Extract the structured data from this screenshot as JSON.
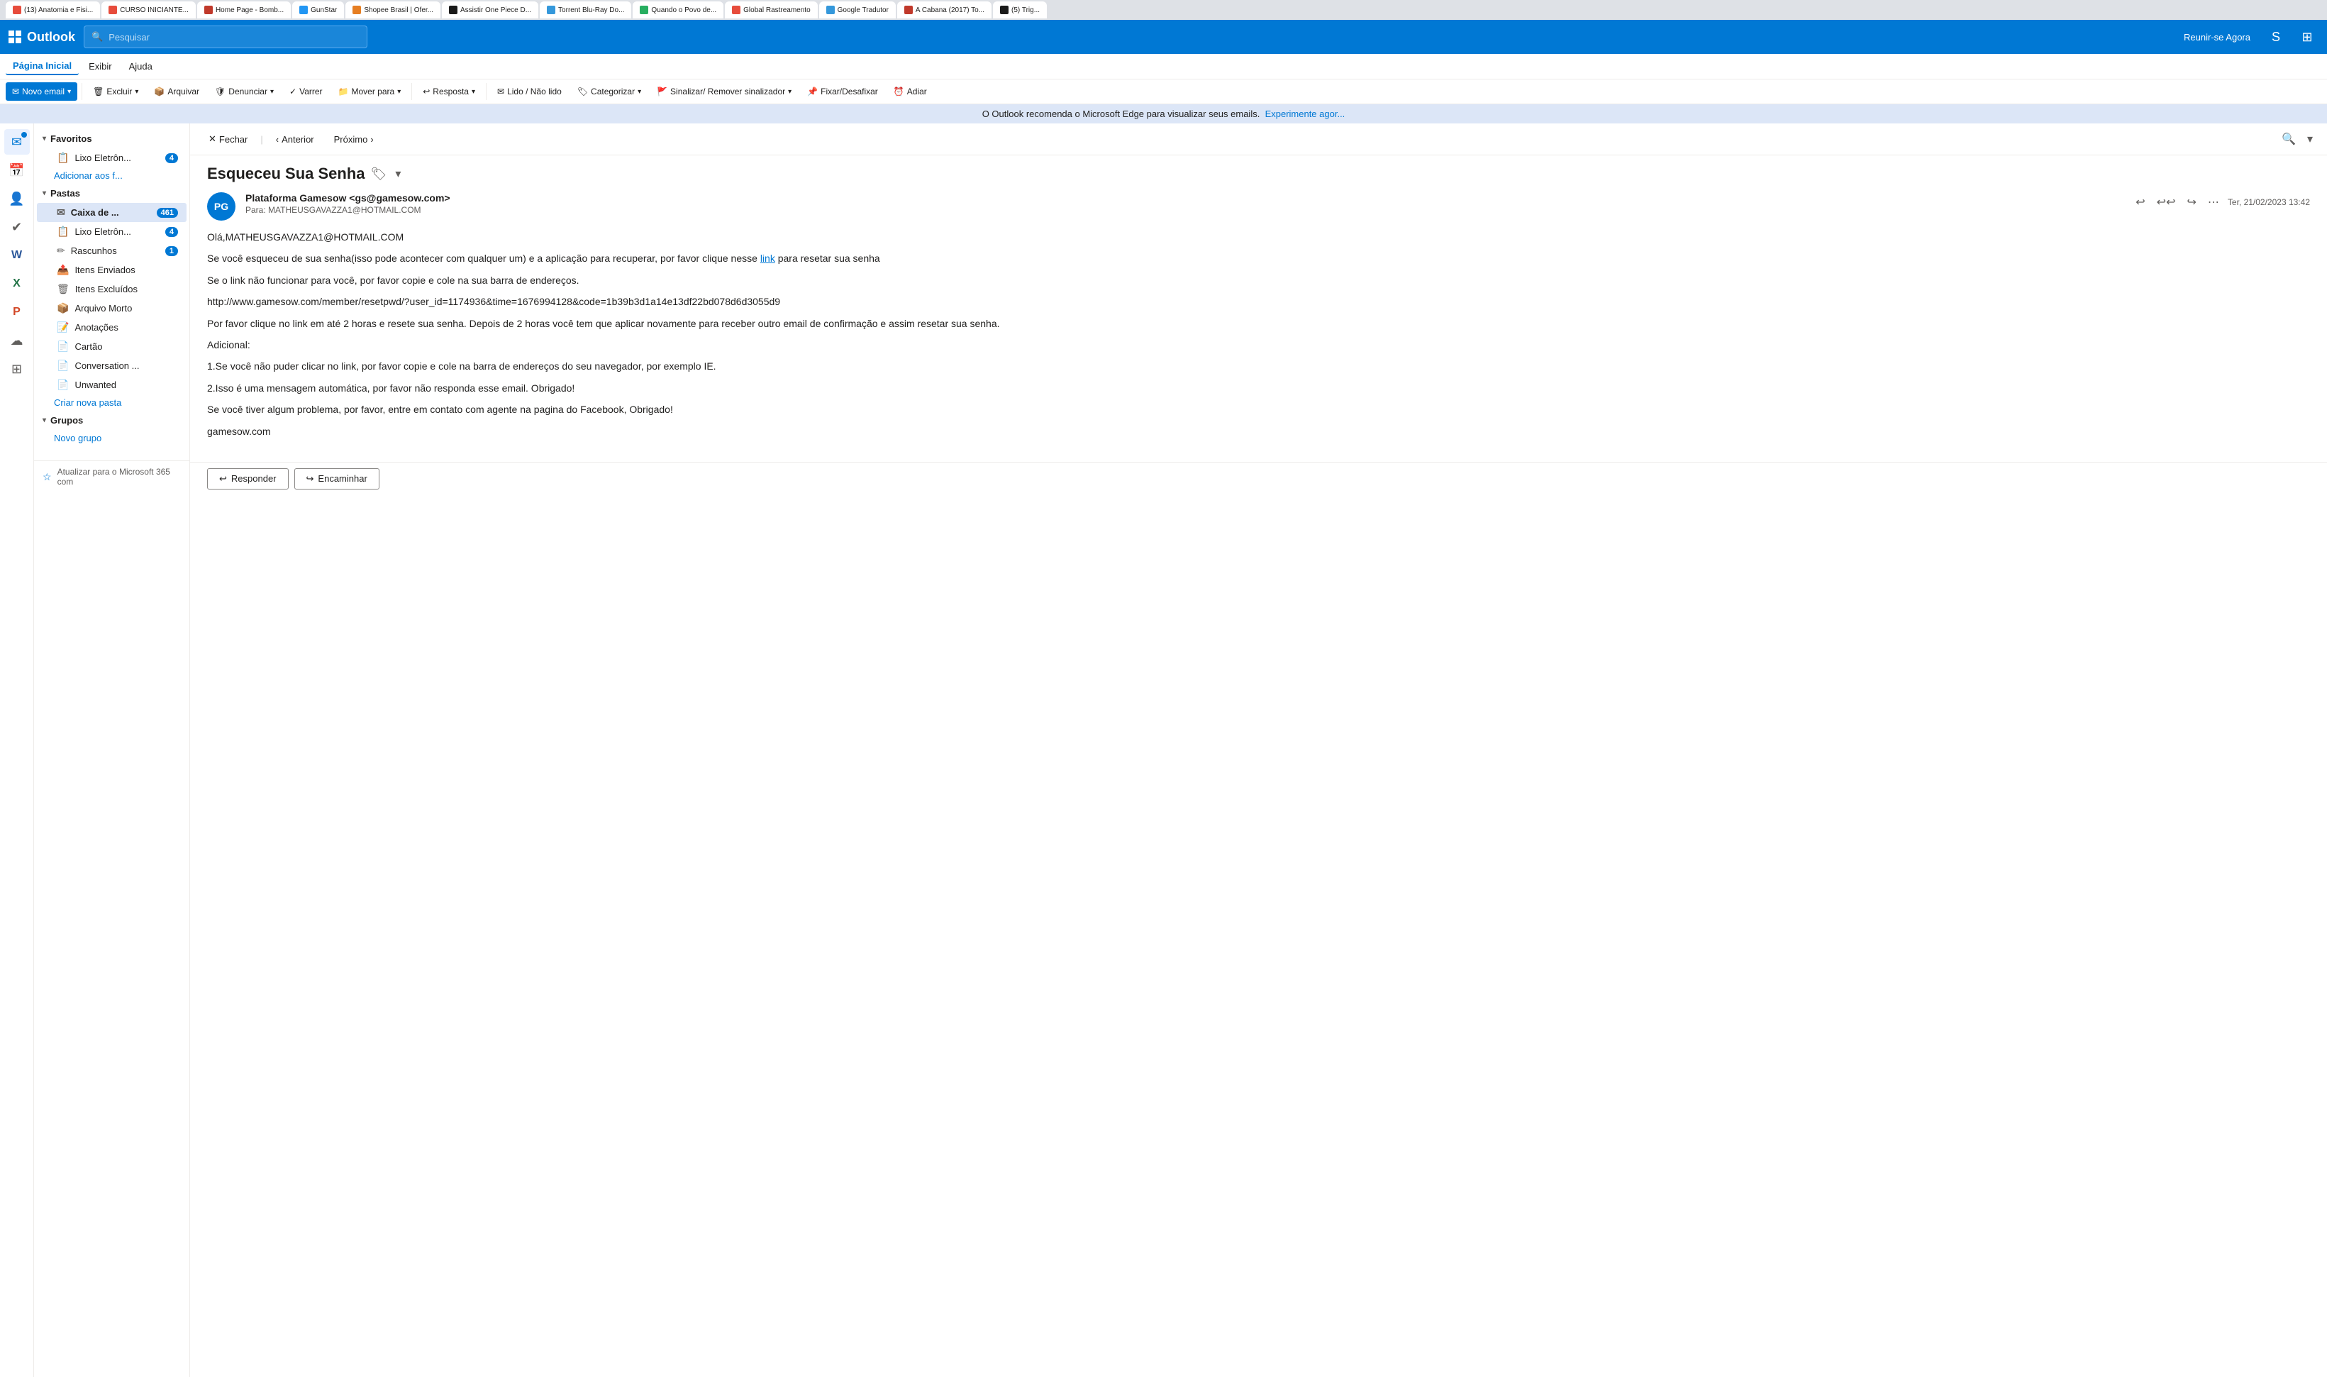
{
  "browser": {
    "tabs": [
      {
        "id": "tab1",
        "favicon_color": "#e74c3c",
        "label": "(13) Anatomia e Fisi...",
        "active": false
      },
      {
        "id": "tab2",
        "favicon_color": "#e74c3c",
        "label": "CURSO INICIANTE...",
        "active": false
      },
      {
        "id": "tab3",
        "favicon_color": "#c0392b",
        "label": "Home Page - Bomb...",
        "active": false
      },
      {
        "id": "tab4",
        "favicon_color": "#2196f3",
        "label": "GunStar",
        "active": false
      },
      {
        "id": "tab5",
        "favicon_color": "#e67e22",
        "label": "Shopee Brasil | Ofer...",
        "active": false
      },
      {
        "id": "tab6",
        "favicon_color": "#1a1a1a",
        "label": "Assistir One Piece D...",
        "active": false
      },
      {
        "id": "tab7",
        "favicon_color": "#3498db",
        "label": "Torrent Blu-Ray Do...",
        "active": false
      },
      {
        "id": "tab8",
        "favicon_color": "#27ae60",
        "label": "Quando o Povo de...",
        "active": false
      },
      {
        "id": "tab9",
        "favicon_color": "#e74c3c",
        "label": "Global Rastreamento",
        "active": false
      },
      {
        "id": "tab10",
        "favicon_color": "#3498db",
        "label": "Google Tradutor",
        "active": false
      },
      {
        "id": "tab11",
        "favicon_color": "#c0392b",
        "label": "A Cabana (2017) To...",
        "active": false
      },
      {
        "id": "tab12",
        "favicon_color": "#1a1a1a",
        "label": "(5) Trig...",
        "active": false
      }
    ]
  },
  "app": {
    "name": "Outlook",
    "logo_text": "Outlook"
  },
  "topbar": {
    "search_placeholder": "Pesquisar",
    "join_button": "Reunir-se Agora"
  },
  "menubar": {
    "items": [
      {
        "id": "home",
        "label": "Página Inicial",
        "active": true
      },
      {
        "id": "view",
        "label": "Exibir",
        "active": false
      },
      {
        "id": "help",
        "label": "Ajuda",
        "active": false
      }
    ]
  },
  "ribbon": {
    "buttons": [
      {
        "id": "new-email",
        "label": "Novo email",
        "primary": true
      },
      {
        "id": "delete",
        "label": "Excluir",
        "icon": "🗑",
        "has_caret": true
      },
      {
        "id": "archive",
        "label": "Arquivar",
        "icon": "📦",
        "has_caret": false
      },
      {
        "id": "report",
        "label": "Denunciar",
        "icon": "🛡",
        "has_caret": true
      },
      {
        "id": "sweep",
        "label": "Varrer",
        "icon": "✓",
        "has_caret": false
      },
      {
        "id": "move",
        "label": "Mover para",
        "icon": "📁",
        "has_caret": true
      },
      {
        "id": "reply",
        "label": "Resposta",
        "icon": "↩",
        "has_caret": true
      },
      {
        "id": "read",
        "label": "Lido / Não lido",
        "icon": "✉",
        "has_caret": false
      },
      {
        "id": "category",
        "label": "Categorizar",
        "icon": "🏷",
        "has_caret": true
      },
      {
        "id": "flag",
        "label": "Sinalizar/ Remover sinalizador",
        "icon": "🚩",
        "has_caret": true
      },
      {
        "id": "pin",
        "label": "Fixar/Desafixar",
        "icon": "📌",
        "has_caret": false
      },
      {
        "id": "delay",
        "label": "Adiar",
        "icon": "⏰",
        "has_caret": false
      }
    ]
  },
  "notification": {
    "text": "O Outlook recomenda o Microsoft Edge para visualizar seus emails.",
    "link_text": "Experimente agor..."
  },
  "sidebar": {
    "favorites_label": "Favoritos",
    "folders_label": "Pastas",
    "groups_label": "Grupos",
    "favorites": [
      {
        "id": "lixo1",
        "icon": "📋",
        "label": "Lixo Eletrôn...",
        "badge": "4"
      },
      {
        "id": "add-fav",
        "label": "Adicionar aos f...",
        "is_link": true
      }
    ],
    "folders": [
      {
        "id": "inbox",
        "icon": "✉",
        "label": "Caixa de ...",
        "badge": "461",
        "active": true
      },
      {
        "id": "lixo2",
        "icon": "📋",
        "label": "Lixo Eletrôn...",
        "badge": "4"
      },
      {
        "id": "drafts",
        "icon": "✏",
        "label": "Rascunhos",
        "badge": "1"
      },
      {
        "id": "sent",
        "icon": "📤",
        "label": "Itens Enviados",
        "badge": ""
      },
      {
        "id": "deleted",
        "icon": "🗑",
        "label": "Itens Excluídos",
        "badge": ""
      },
      {
        "id": "archive2",
        "icon": "📦",
        "label": "Arquivo Morto",
        "badge": ""
      },
      {
        "id": "notes",
        "icon": "📝",
        "label": "Anotações",
        "badge": ""
      },
      {
        "id": "card",
        "icon": "📄",
        "label": "Cartão",
        "badge": ""
      },
      {
        "id": "conversation",
        "icon": "📄",
        "label": "Conversation ...",
        "badge": ""
      },
      {
        "id": "unwanted",
        "icon": "📄",
        "label": "Unwanted",
        "badge": ""
      }
    ],
    "new_folder_link": "Criar nova pasta",
    "new_group_link": "Novo grupo",
    "update_bar": "Atualizar para o Microsoft 365 com"
  },
  "email": {
    "toolbar": {
      "close_label": "Fechar",
      "prev_label": "Anterior",
      "next_label": "Próximo"
    },
    "subject": "Esqueceu Sua Senha",
    "sender": "Plataforma Gamesow <gs@gamesow.com>",
    "sender_initials": "PG",
    "to": "Para: MATHEUSGAVAZZA1@HOTMAIL.COM",
    "date": "Ter, 21/02/2023 13:42",
    "body_lines": [
      "Olá,MATHEUSGAVAZZA1@HOTMAIL.COM",
      "Se você esqueceu de sua senha(isso pode acontecer com qualquer um) e a aplicação para recuperar, por favor clique nesse link para resetar sua senha",
      "Se o link não funcionar para você, por favor copie e cole na sua barra de endereços.",
      "http://www.gamesow.com/member/resetpwd/?user_id=1174936&time=1676994128&code=1b39b3d1a14e13df22bd078d6d3055d9",
      "Por favor clique no link em até 2 horas e resete sua senha. Depois de 2 horas você tem que aplicar novamente para receber outro email de confirmação e assim resetar sua senha.",
      "Adicional:",
      "1.Se você não puder clicar no link, por favor copie e cole na barra de endereços do seu navegador, por exemplo IE.",
      "2.Isso é uma mensagem automática, por favor não responda esse email. Obrigado!",
      "Se você tiver algum problema, por favor, entre em contato com agente na pagina do Facebook, Obrigado!",
      "gamesow.com"
    ],
    "reply_label": "Responder",
    "forward_label": "Encaminhar"
  }
}
